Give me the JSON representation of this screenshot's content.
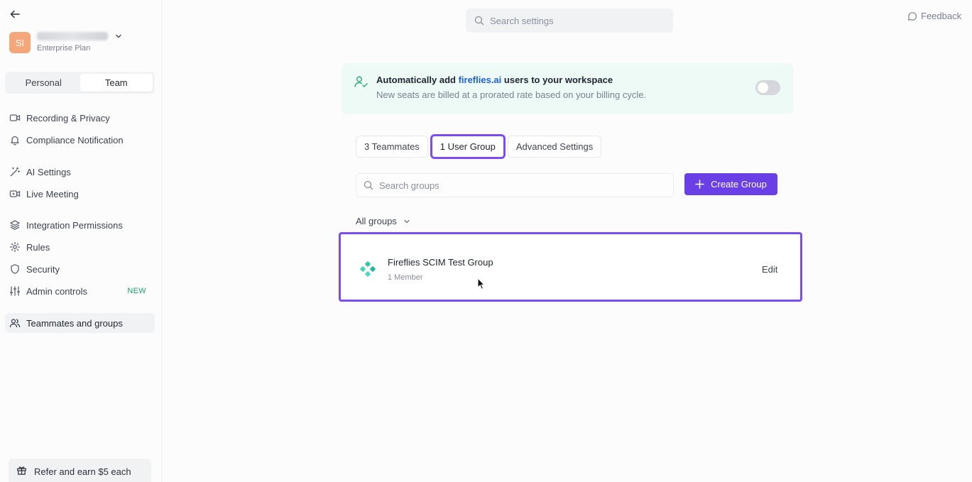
{
  "workspace": {
    "initials": "SI",
    "plan": "Enterprise Plan"
  },
  "mode_switch": {
    "personal": "Personal",
    "team": "Team"
  },
  "nav": {
    "recording": "Recording & Privacy",
    "compliance": "Compliance Notification",
    "ai_settings": "AI Settings",
    "live_meeting": "Live Meeting",
    "integration": "Integration Permissions",
    "rules": "Rules",
    "security": "Security",
    "admin": "Admin controls",
    "admin_badge": "NEW",
    "teammates": "Teammates and groups"
  },
  "refer": {
    "label": "Refer and earn $5 each"
  },
  "top": {
    "search_placeholder": "Search settings",
    "feedback": "Feedback"
  },
  "banner": {
    "title_prefix": "Automatically add ",
    "title_link": "fireflies.ai",
    "title_suffix": " users to your workspace",
    "subtitle": "New seats are billed at a prorated rate based on your billing cycle."
  },
  "tabs": {
    "teammates": "3 Teammates",
    "groups": "1 User Group",
    "advanced": "Advanced Settings"
  },
  "groups": {
    "search_placeholder": "Search groups",
    "create_label": "Create Group",
    "filter_label": "All groups",
    "items": [
      {
        "name": "Fireflies SCIM Test Group",
        "members": "1 Member",
        "edit": "Edit"
      }
    ]
  },
  "colors": {
    "accent": "#6b3fe6",
    "highlight": "#7b4cf0",
    "banner_bg": "#eefaf5",
    "link": "#1d5fd6",
    "avatar": "#f5a77a",
    "group_icon": "#2ec8a6"
  }
}
